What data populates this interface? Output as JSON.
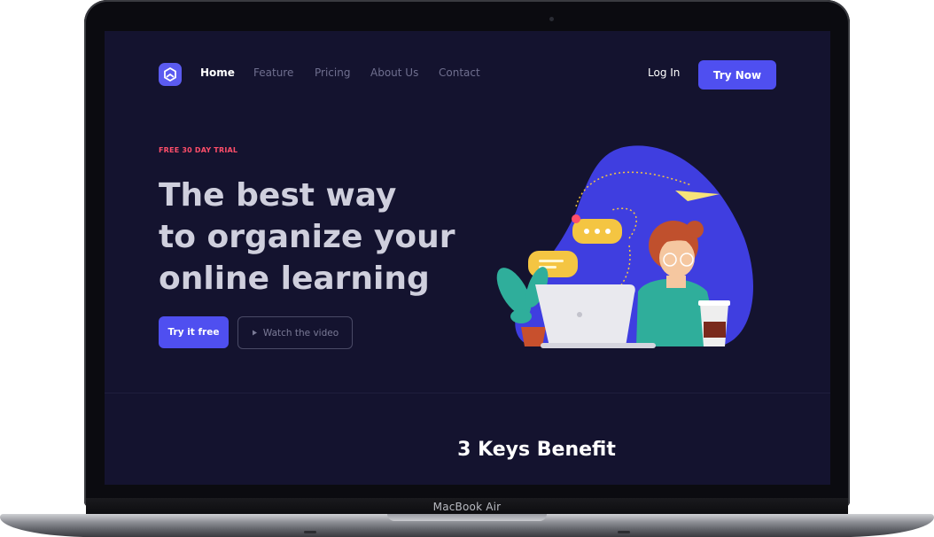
{
  "nav": {
    "items": [
      {
        "label": "Home",
        "active": true
      },
      {
        "label": "Feature",
        "active": false
      },
      {
        "label": "Pricing",
        "active": false
      },
      {
        "label": "About Us",
        "active": false
      },
      {
        "label": "Contact",
        "active": false
      }
    ],
    "login_label": "Log In",
    "cta_label": "Try Now"
  },
  "hero": {
    "badge": "FREE 30 DAY TRIAL",
    "headline_lines": [
      "The best way",
      "to organize your",
      "online learning"
    ],
    "primary_button": "Try it free",
    "secondary_button": "Watch the video",
    "secondary_icon": "play-icon",
    "illustration": "person-with-laptop-illustration"
  },
  "benefits": {
    "title": "3 Keys Benefit"
  },
  "device": {
    "label": "MacBook Air"
  },
  "colors": {
    "background": "#14132f",
    "accent": "#4f4ff0",
    "badge": "#ff4e6a",
    "blob": "#3f3ee0"
  }
}
